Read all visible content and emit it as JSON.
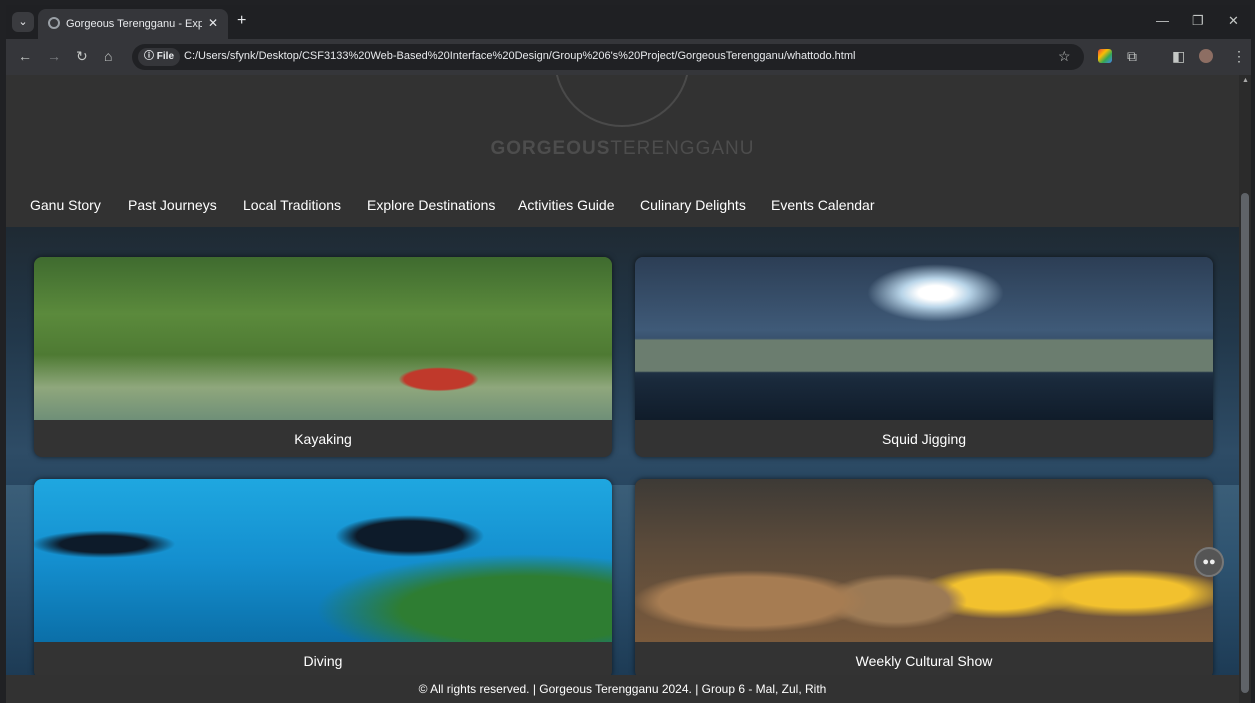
{
  "browser": {
    "tab_title": "Gorgeous Terengganu - Explore",
    "tab_close": "✕",
    "new_tab": "+",
    "file_chip": "ⓘ File",
    "url": "C:/Users/sfynk/Desktop/CSF3133%20Web-Based%20Interface%20Design/Group%206's%20Project/GorgeousTerengganu/whattodo.html"
  },
  "header": {
    "logo_bold": "GORGEOUS",
    "logo_light": "TERENGGANU"
  },
  "nav": {
    "items": [
      "Ganu Story",
      "Past Journeys",
      "Local Traditions",
      "Explore Destinations",
      "Activities Guide",
      "Culinary Delights",
      "Events Calendar"
    ]
  },
  "activities": [
    {
      "label": "Kayaking"
    },
    {
      "label": "Squid Jigging"
    },
    {
      "label": "Diving"
    },
    {
      "label": "Weekly Cultural Show"
    }
  ],
  "footer": {
    "text": "© All rights reserved. | Gorgeous Terengganu 2024. | Group 6 - Mal, Zul, Rith"
  }
}
